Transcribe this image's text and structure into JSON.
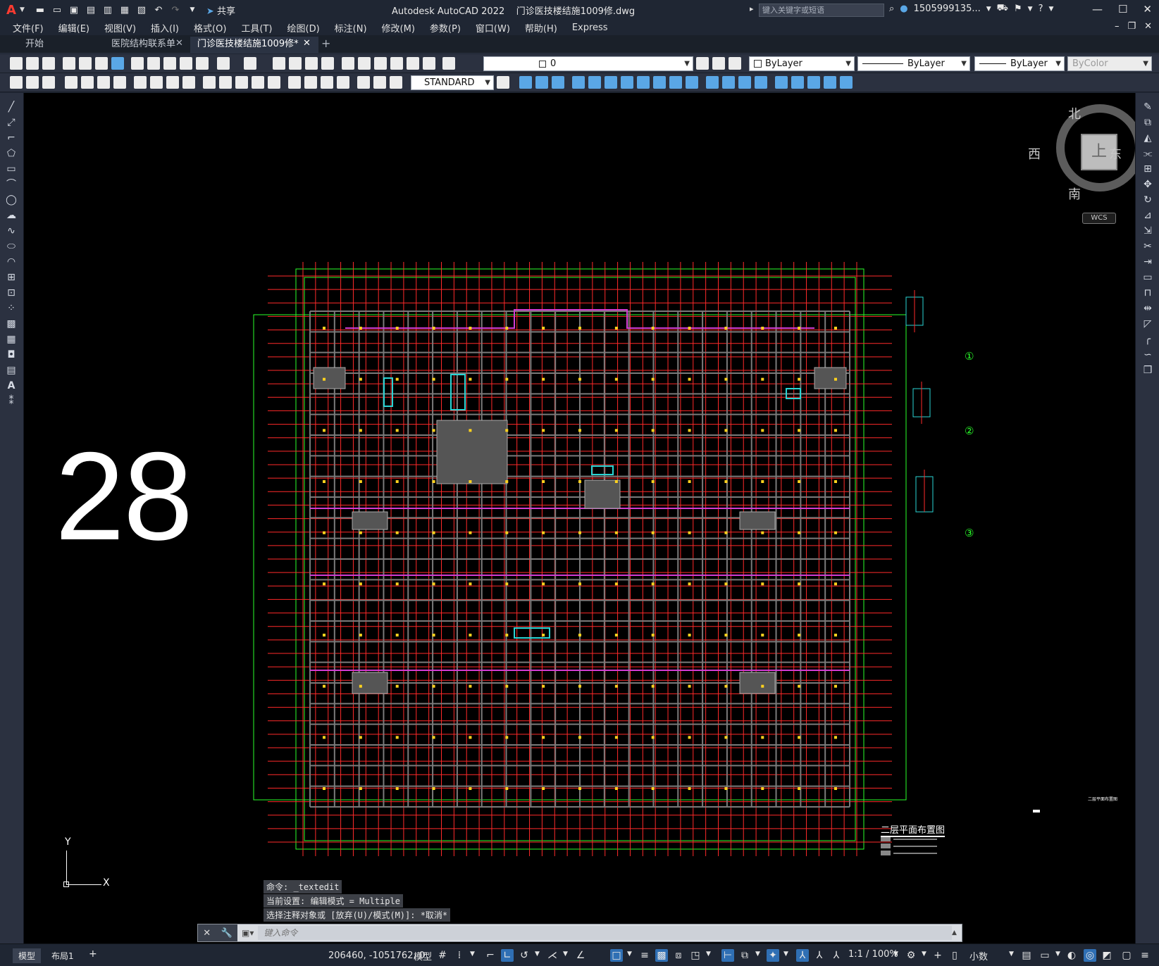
{
  "app": {
    "logo": "A",
    "title": "Autodesk AutoCAD 2022",
    "document": "门诊医技楼结施1009修.dwg",
    "share_label": "共享",
    "search_placeholder": "键入关键字或短语",
    "user": "1505999135...",
    "colors": {
      "accent": "#2f6fb4",
      "canvas": "#000000",
      "chrome": "#1f2633",
      "grid_red": "#ff2a2a",
      "grid_green": "#2aff2a"
    }
  },
  "menu": [
    "文件(F)",
    "编辑(E)",
    "视图(V)",
    "插入(I)",
    "格式(O)",
    "工具(T)",
    "绘图(D)",
    "标注(N)",
    "修改(M)",
    "参数(P)",
    "窗口(W)",
    "帮助(H)",
    "Express"
  ],
  "tabs": [
    {
      "label": "开始",
      "closable": false,
      "active": false
    },
    {
      "label": "医院结构联系单",
      "closable": true,
      "active": false
    },
    {
      "label": "门诊医技楼结施1009修*",
      "closable": true,
      "active": true
    }
  ],
  "toolbar": {
    "layer": "0",
    "color": "ByLayer",
    "linetype": "ByLayer",
    "lineweight": "ByLayer",
    "plotstyle": "ByColor",
    "textstyle": "STANDARD"
  },
  "viewcube": {
    "face": "上",
    "north": "北",
    "south": "南",
    "east": "东",
    "west": "西",
    "wcs": "WCS"
  },
  "drawing": {
    "big_number": "28",
    "plan_title": "二层平面布置图",
    "detail_labels": [
      "①",
      "②",
      "③"
    ],
    "right_note": "二层平面布置图"
  },
  "ucs": {
    "x": "X",
    "y": "Y"
  },
  "command": {
    "history": [
      "命令: _textedit",
      "当前设置: 编辑模式 = Multiple",
      "选择注释对象或 [放弃(U)/模式(M)]: *取消*"
    ],
    "placeholder": "键入命令"
  },
  "status": {
    "layouts": [
      "模型",
      "布局1"
    ],
    "coords": "206460, -1051762, 0",
    "space": "模型",
    "scale": "1:1 / 100%",
    "units": "小数"
  }
}
